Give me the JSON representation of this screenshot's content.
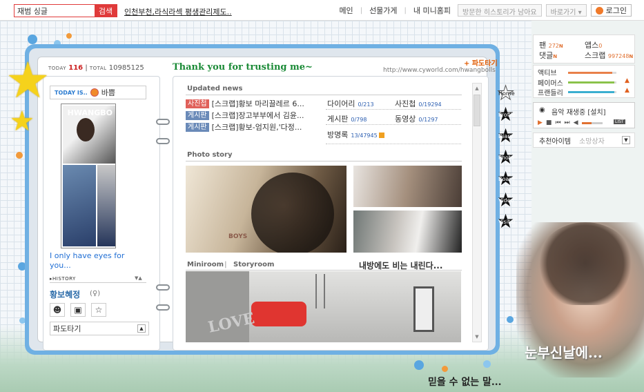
{
  "topbar": {
    "search_value": "재범 싱글",
    "search_button": "검색",
    "news_ticker": "인천부천,라식라섹 평생관리제도..",
    "nav": [
      "메인",
      "선물가게",
      "내 미니홈피"
    ],
    "history_button": "방문한 히스토리가 남아요",
    "goto_select": "바로가기",
    "login_button": "로그인"
  },
  "header": {
    "today_label": "TODAY",
    "today_count": "116",
    "total_label": "TOTAL",
    "total_count": "10985125",
    "title": "Thank you for trusting me~",
    "url": "http://www.cyworld.com/hwangbolls",
    "wave_link": "+ 파도타기"
  },
  "profile": {
    "today_is_label": "TODAY IS..",
    "mood": "바쁨",
    "photo_brand": "HWANGBO",
    "message": "I only have eyes for you...",
    "history_label": "HISTORY",
    "owner_name": "황보혜정",
    "owner_gender": "(♀)",
    "surf_select": "파도타기"
  },
  "updated_news": {
    "title": "Updated news",
    "items": [
      {
        "category": "사진첩",
        "color": "red",
        "text": "[스크랩]황보 마리끌레르 6..."
      },
      {
        "category": "게시판",
        "color": "blue",
        "text": "[스크랩]장고부부에서 김윤..."
      },
      {
        "category": "게시판",
        "color": "blue",
        "text": "[스크랩]황보-엄지원,'다정..."
      }
    ],
    "stats": {
      "diary_label": "다이어리",
      "diary_count": "0/213",
      "photo_label": "사진첩",
      "photo_count": "0/19294",
      "board_label": "게시판",
      "board_count": "0/798",
      "video_label": "동영상",
      "video_count": "0/1297",
      "guest_label": "방명록",
      "guest_count": "13/47945"
    }
  },
  "photo_story": {
    "title": "Photo story",
    "main_caption": "BOYS"
  },
  "miniroom": {
    "tab_miniroom": "Miniroom",
    "tab_storyroom": "Storyroom",
    "title": "내방에도 비는 내린다...",
    "art_text": "LOVE"
  },
  "side_tabs": [
    "Home",
    "Profile",
    "Diary",
    "Photo",
    "Board",
    "Video",
    "Visitor"
  ],
  "sidebar": {
    "fan_label": "팬",
    "fan_value": "272",
    "apps_label": "앱스",
    "apps_value": "0",
    "comments_label": "댓글",
    "scrap_label": "스크랩",
    "scrap_value": "997248",
    "new_mark": "N",
    "bars": [
      {
        "label": "액티브",
        "color": "#e8804a",
        "level": 0.92
      },
      {
        "label": "페이머스",
        "color": "#8ac24a",
        "level": 0.95
      },
      {
        "label": "프랜들리",
        "color": "#3aaed0",
        "level": 0.95
      }
    ],
    "music_title": "음악 재생중 [설치]",
    "music_list": "LIST",
    "recommend": "추천아이템",
    "recommend_sub": "소망상자"
  },
  "captions": {
    "right": "눈부신날에...",
    "bottom": "믿을 수 없는 말..."
  }
}
